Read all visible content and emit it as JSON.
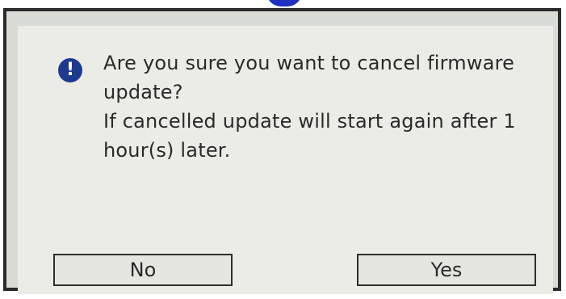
{
  "dialog": {
    "icon": "exclamation-icon",
    "message_lines": [
      "Are you sure you want to cancel firmware",
      "update?",
      "If cancelled update will start again after 1",
      "hour(s) later."
    ],
    "buttons": {
      "no_label": "No",
      "yes_label": "Yes"
    }
  },
  "colors": {
    "icon_fill": "#1e3a8f",
    "dialog_bg": "#ecece6",
    "frame_border": "#2a2a2a"
  }
}
